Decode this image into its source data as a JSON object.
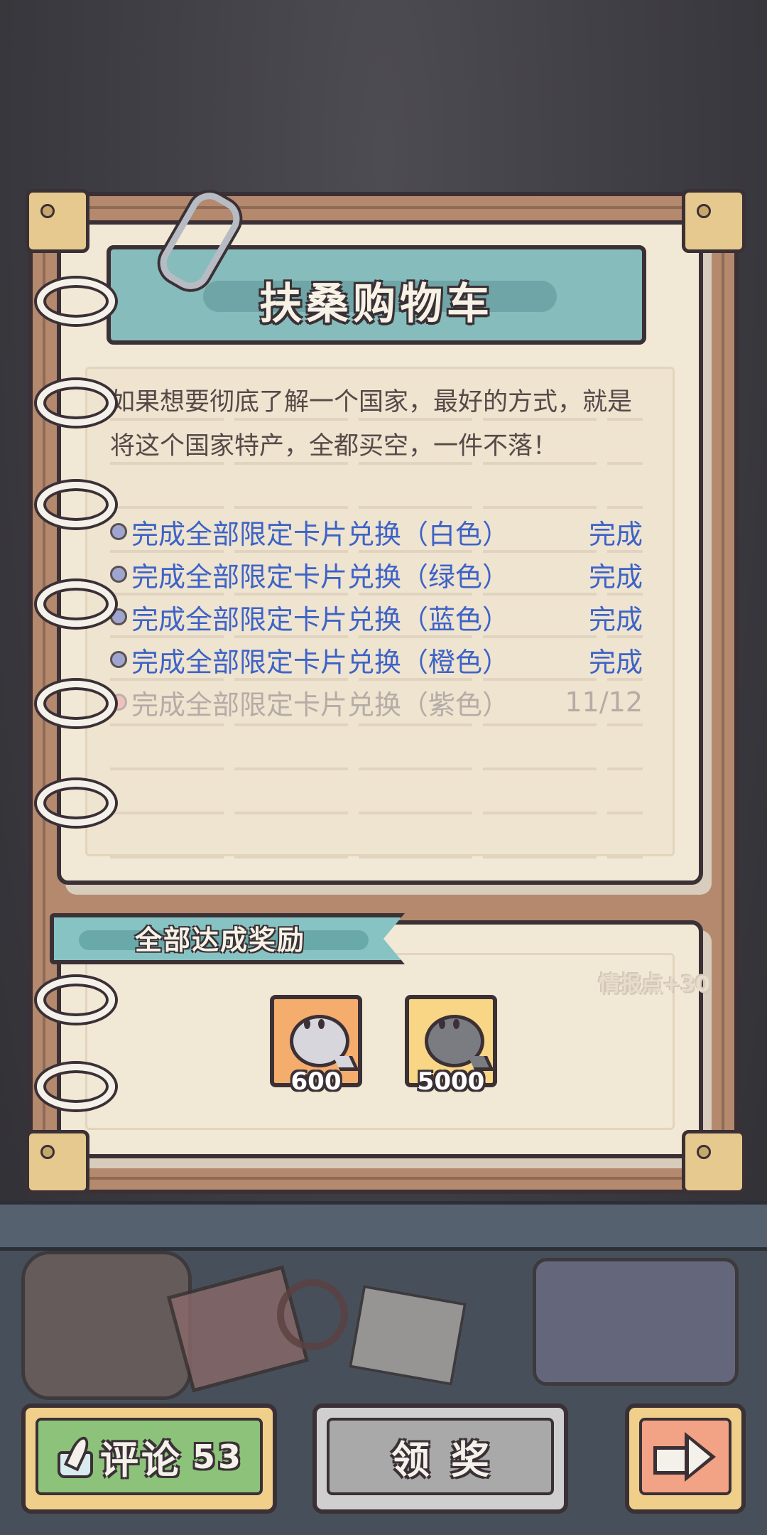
{
  "header": {
    "title": "扶桑购物车"
  },
  "description": "如果想要彻底了解一个国家，最好的方式，就是将这个国家特产，全都买空，一件不落！",
  "tasks": [
    {
      "label": "完成全部限定卡片兑换（白色）",
      "status": "完成",
      "state": "done"
    },
    {
      "label": "完成全部限定卡片兑换（绿色）",
      "status": "完成",
      "state": "done"
    },
    {
      "label": "完成全部限定卡片兑换（蓝色）",
      "status": "完成",
      "state": "done"
    },
    {
      "label": "完成全部限定卡片兑换（橙色）",
      "status": "完成",
      "state": "done"
    },
    {
      "label": "完成全部限定卡片兑换（紫色）",
      "status": "11/12",
      "state": "pending"
    }
  ],
  "rewards": {
    "title": "全部达成奖励",
    "intel_label": "情报点+30",
    "items": [
      {
        "icon": "ghost-bubble-icon",
        "count": "600"
      },
      {
        "icon": "dark-ghost-bubble-icon",
        "count": "5000"
      }
    ]
  },
  "buttons": {
    "comment_label": "评论",
    "comment_count": "53",
    "claim_label": "领奖",
    "next_icon": "arrow-right-icon"
  },
  "colors": {
    "done": "#3d63c7",
    "pending": "#b5aca6",
    "banner": "#87bcbc",
    "comment_button": "#8cc27a",
    "claim_button": "#a9a9a9",
    "next_button": "#f2a285"
  }
}
